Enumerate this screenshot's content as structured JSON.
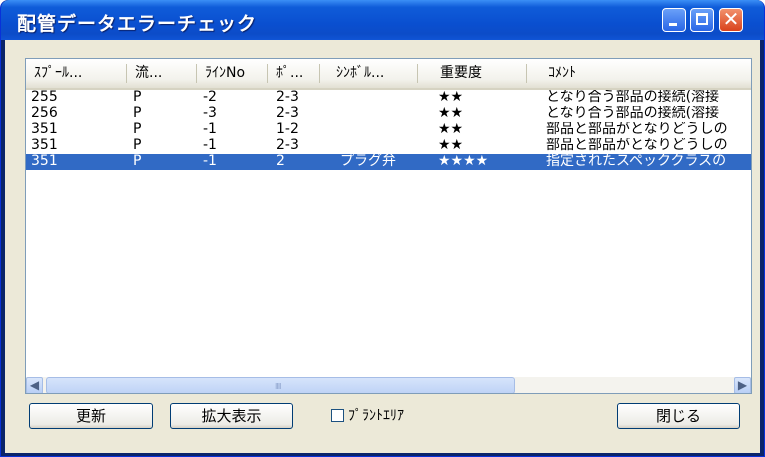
{
  "window": {
    "title": "配管データエラーチェック"
  },
  "columns": [
    {
      "label": "ｽﾌﾟｰﾙ..."
    },
    {
      "label": "流..."
    },
    {
      "label": "ﾗｲﾝNo"
    },
    {
      "label": "ﾎﾟ..."
    },
    {
      "label": "ｼﾝﾎﾞﾙ..."
    },
    {
      "label": "重要度"
    },
    {
      "label": "ｺﾒﾝﾄ"
    }
  ],
  "rows": [
    {
      "spool": "255",
      "flow": "P",
      "line_no": "-2",
      "port": "2-3",
      "symbol": "",
      "severity": "★★",
      "comment": "となり合う部品の接続(溶接"
    },
    {
      "spool": "256",
      "flow": "P",
      "line_no": "-3",
      "port": "2-3",
      "symbol": "",
      "severity": "★★",
      "comment": "となり合う部品の接続(溶接"
    },
    {
      "spool": "351",
      "flow": "P",
      "line_no": "-1",
      "port": "1-2",
      "symbol": "",
      "severity": "★★",
      "comment": "部品と部品がとなりどうしの"
    },
    {
      "spool": "351",
      "flow": "P",
      "line_no": "-1",
      "port": "2-3",
      "symbol": "",
      "severity": "★★",
      "comment": "部品と部品がとなりどうしの"
    },
    {
      "spool": "351",
      "flow": "P",
      "line_no": "-1",
      "port": "2",
      "symbol": "プラグ弁",
      "severity": "★★★★",
      "comment": "指定されたスペッククラスの",
      "selected": true
    }
  ],
  "scrollbar": {
    "thumb_grip": "IIII"
  },
  "buttons": {
    "refresh": "更新",
    "zoom": "拡大表示",
    "close": "閉じる"
  },
  "checkbox": {
    "label": "ﾌﾟﾗﾝﾄｴﾘｱ",
    "checked": false
  },
  "colors": {
    "selection": "#316ac5",
    "titlebar": "#0a4fd0",
    "client": "#ece9d8"
  },
  "icons": {
    "minimize": "minimize-icon",
    "maximize": "maximize-icon",
    "close": "close-icon",
    "scroll_left": "arrow-left-icon",
    "scroll_right": "arrow-right-icon"
  }
}
